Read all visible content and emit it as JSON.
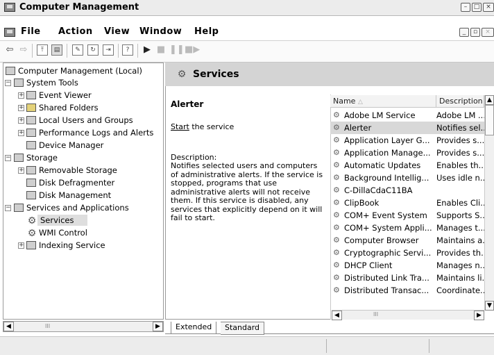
{
  "window": {
    "title": "Computer Management"
  },
  "menu": [
    "File",
    "Action",
    "View",
    "Window",
    "Help"
  ],
  "tree": [
    {
      "label": "Computer Management (Local)",
      "icon": "computer-icon"
    },
    {
      "label": "System Tools",
      "icon": "tools-icon"
    },
    {
      "label": "Event Viewer",
      "icon": "event-viewer-icon"
    },
    {
      "label": "Shared Folders",
      "icon": "folder-icon"
    },
    {
      "label": "Local Users and Groups",
      "icon": "users-icon"
    },
    {
      "label": "Performance Logs and Alerts",
      "icon": "performance-icon"
    },
    {
      "label": "Device Manager",
      "icon": "device-manager-icon"
    },
    {
      "label": "Storage",
      "icon": "storage-icon"
    },
    {
      "label": "Removable Storage",
      "icon": "removable-storage-icon"
    },
    {
      "label": "Disk Defragmenter",
      "icon": "defrag-icon"
    },
    {
      "label": "Disk Management",
      "icon": "disk-management-icon"
    },
    {
      "label": "Services and Applications",
      "icon": "services-apps-icon"
    },
    {
      "label": "Services",
      "icon": "services-icon"
    },
    {
      "label": "WMI Control",
      "icon": "wmi-icon"
    },
    {
      "label": "Indexing Service",
      "icon": "indexing-icon"
    }
  ],
  "panel": {
    "header": "Services",
    "selected_name": "Alerter",
    "start_link": "Start",
    "start_rest": " the service",
    "description_label": "Description:",
    "description": "Notifies selected users and computers of administrative alerts. If the service is stopped, programs that use administrative alerts will not receive them. If this service is disabled, any services that explicitly depend on it will fail to start."
  },
  "list": {
    "columns": [
      "Name",
      "Description"
    ],
    "rows": [
      {
        "name": "Adobe LM Service",
        "desc": "Adobe LM ..."
      },
      {
        "name": "Alerter",
        "desc": "Notifies sel..."
      },
      {
        "name": "Application Layer G...",
        "desc": "Provides s..."
      },
      {
        "name": "Application Manage...",
        "desc": "Provides s..."
      },
      {
        "name": "Automatic Updates",
        "desc": "Enables th..."
      },
      {
        "name": "Background Intellig...",
        "desc": "Uses idle n..."
      },
      {
        "name": "C-DillaCdaC11BA",
        "desc": ""
      },
      {
        "name": "ClipBook",
        "desc": "Enables Cli..."
      },
      {
        "name": "COM+ Event System",
        "desc": "Supports S..."
      },
      {
        "name": "COM+ System Appli...",
        "desc": "Manages t..."
      },
      {
        "name": "Computer Browser",
        "desc": "Maintains a..."
      },
      {
        "name": "Cryptographic Servi...",
        "desc": "Provides th..."
      },
      {
        "name": "DHCP Client",
        "desc": "Manages n..."
      },
      {
        "name": "Distributed Link Tra...",
        "desc": "Maintains li..."
      },
      {
        "name": "Distributed Transac...",
        "desc": "Coordinate..."
      }
    ]
  },
  "tabs": [
    "Extended",
    "Standard"
  ],
  "tree_scroll_label": "III",
  "list_scroll_label": "III"
}
